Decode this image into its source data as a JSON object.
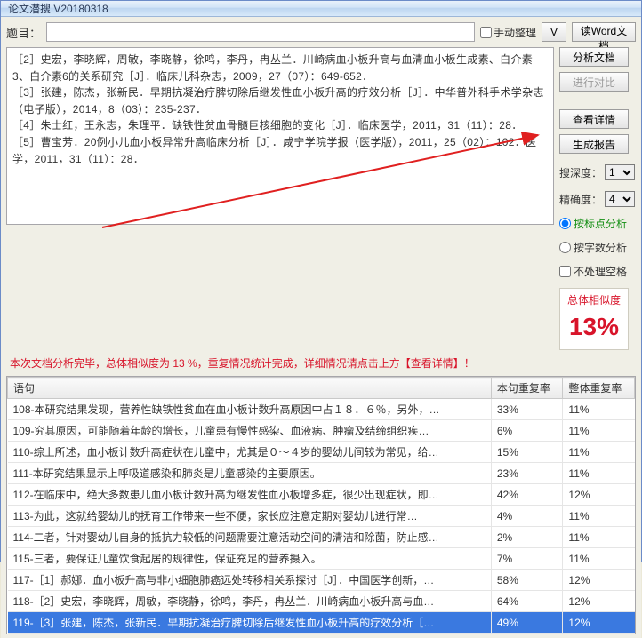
{
  "app_title": "论文潜搜 V20180318",
  "topic_label": "题目：",
  "manual_sort": "手动整理",
  "buttons": {
    "v": "V",
    "read_word": "读Word文档",
    "analyze": "分析文档",
    "compare": "进行对比",
    "detail": "查看详情",
    "report": "生成报告"
  },
  "refs": [
    "［2］史宏，李晓辉，周敏，李晓静，徐鸣，李丹，冉丛兰．川崎病血小板升高与血清血小板生成素、白介素3、白介素6的关系研究［J］．临床儿科杂志，2009，27（07）：649-652．",
    "［3］张建，陈杰，张新民．早期抗凝治疗脾切除后继发性血小板升高的疗效分析［J］．中华普外科手术学杂志（电子版），2014，8（03）：235-237．",
    "［4］朱士红，王永志，朱理平．缺铁性贫血骨髓巨核细胞的变化［J］．临床医学，2011，31（11）：28．",
    "［5］曹宝芳．20例小儿血小板异常升高临床分析［J］．咸宁学院学报（医学版），2011，25（02）：102．医学，2011，31（11）：28．"
  ],
  "depth_label": "搜深度：",
  "depth_value": "1",
  "accuracy_label": "精确度：",
  "accuracy_value": "4",
  "radio_punct": "按标点分析",
  "radio_chars": "按字数分析",
  "check_nospace": "不处理空格",
  "sim_label": "总体相似度",
  "sim_value": "13%",
  "status_line": "本次文档分析完毕，总体相似度为 13 %，重复情况统计完成，详细情况请点击上方【查看详情】！",
  "cols": {
    "c1": "语句",
    "c2": "本句重复率",
    "c3": "整体重复率"
  },
  "rows": [
    {
      "t": "108-本研究结果发现，营养性缺铁性贫血在血小板计数升高原因中占１８．６％，另外，…",
      "a": "33%",
      "b": "11%"
    },
    {
      "t": "109-究其原因，可能随着年龄的增长，儿童患有慢性感染、血液病、肿瘤及结缔组织疾…",
      "a": "6%",
      "b": "11%"
    },
    {
      "t": "110-综上所述，血小板计数升高症状在儿童中，尤其是０～４岁的婴幼儿间较为常见，给…",
      "a": "15%",
      "b": "11%"
    },
    {
      "t": "111-本研究结果显示上呼吸道感染和肺炎是儿童感染的主要原因。",
      "a": "23%",
      "b": "11%"
    },
    {
      "t": "112-在临床中，绝大多数患儿血小板计数升高为继发性血小板增多症，很少出现症状，即…",
      "a": "42%",
      "b": "12%"
    },
    {
      "t": "113-为此，这就给婴幼儿的抚育工作带来一些不便，家长应注意定期对婴幼儿进行常…",
      "a": "4%",
      "b": "11%"
    },
    {
      "t": "114-二者，针对婴幼儿自身的抵抗力较低的问题需要注意活动空间的清洁和除菌，防止感…",
      "a": "2%",
      "b": "11%"
    },
    {
      "t": "115-三者，要保证儿童饮食起居的规律性，保证充足的营养摄入。",
      "a": "7%",
      "b": "11%"
    },
    {
      "t": "117-［1］郝娜．血小板升高与非小细胞肺癌远处转移相关系探讨［J］．中国医学创新，…",
      "a": "58%",
      "b": "12%"
    },
    {
      "t": "118-［2］史宏，李晓辉，周敏，李晓静，徐鸣，李丹，冉丛兰．川崎病血小板升高与血…",
      "a": "64%",
      "b": "12%"
    },
    {
      "t": "119-［3］张建，陈杰，张新民．早期抗凝治疗脾切除后继发性血小板升高的疗效分析［…",
      "a": "49%",
      "b": "12%",
      "sel": true
    }
  ]
}
